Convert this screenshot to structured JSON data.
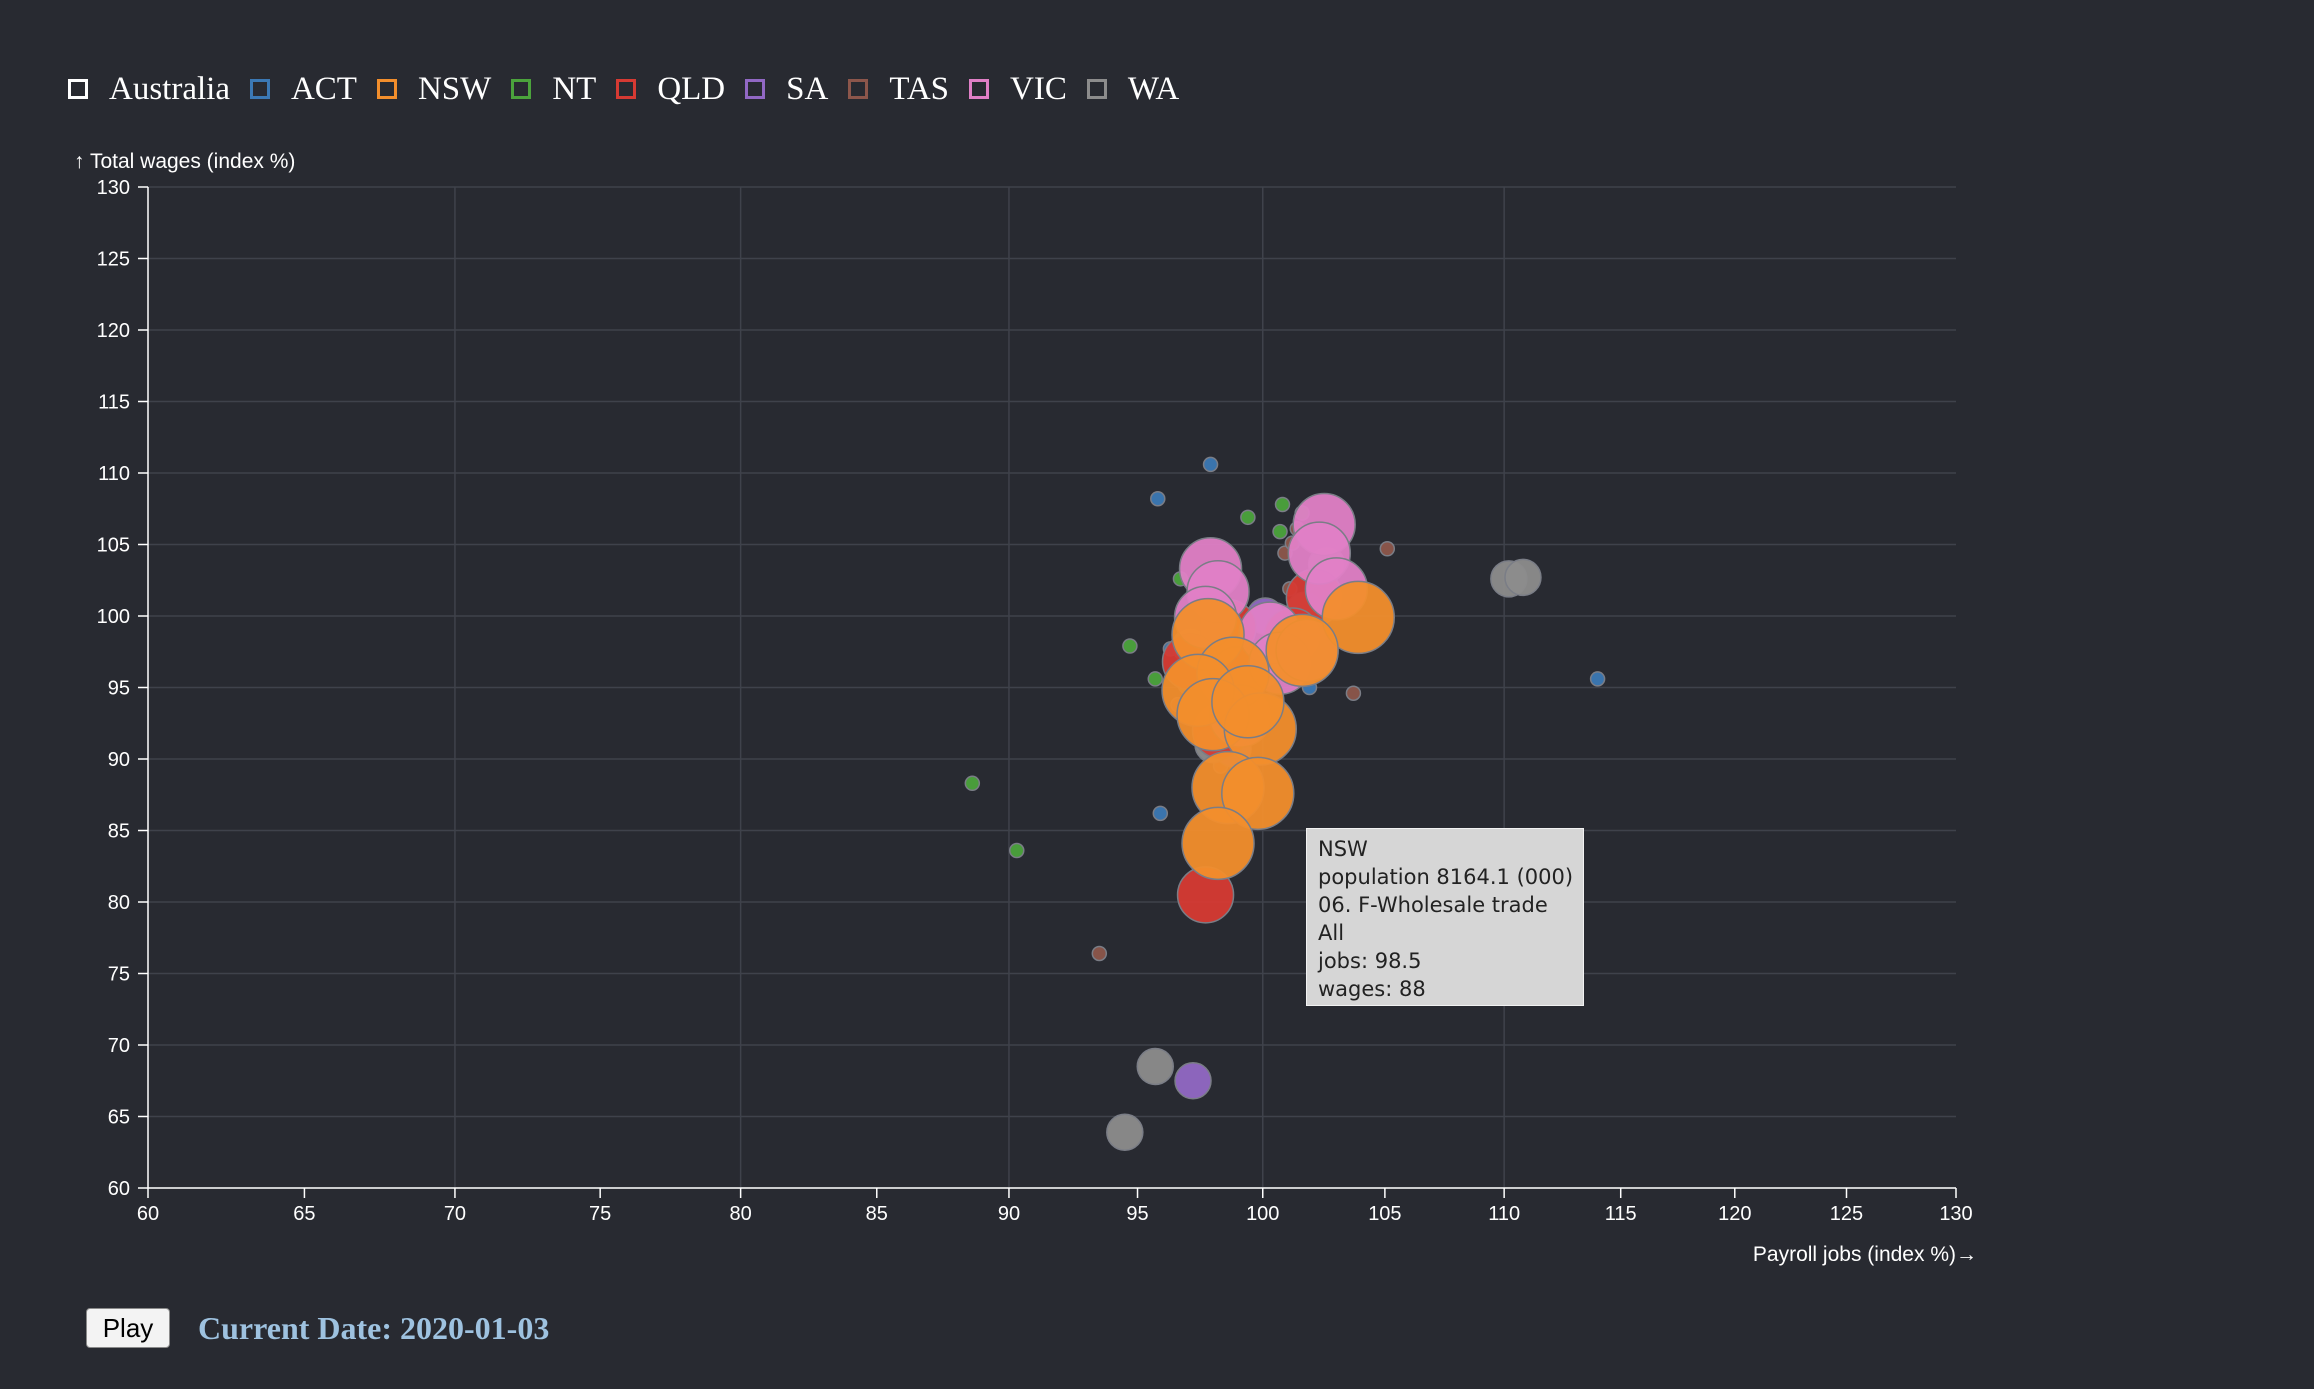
{
  "legend": [
    {
      "label": "Australia",
      "color": "#ffffff",
      "icon": "square-outline-icon"
    },
    {
      "label": "ACT",
      "color": "#3b78b4",
      "icon": "square-icon"
    },
    {
      "label": "NSW",
      "color": "#f28e2c",
      "icon": "square-icon"
    },
    {
      "label": "NT",
      "color": "#4ba33c",
      "icon": "square-icon"
    },
    {
      "label": "QLD",
      "color": "#d63a33",
      "icon": "square-icon"
    },
    {
      "label": "SA",
      "color": "#9168c4",
      "icon": "square-icon"
    },
    {
      "label": "TAS",
      "color": "#8c564b",
      "icon": "square-icon"
    },
    {
      "label": "VIC",
      "color": "#e07fc6",
      "icon": "square-icon"
    },
    {
      "label": "WA",
      "color": "#8c8c8c",
      "icon": "square-icon"
    }
  ],
  "chart_data": {
    "type": "scatter",
    "title": "",
    "xlabel": "Payroll jobs (index %)",
    "ylabel": "Total wages (index %)",
    "xlim": [
      60,
      130
    ],
    "ylim": [
      60,
      130
    ],
    "x_ticks": [
      60,
      65,
      70,
      75,
      80,
      85,
      90,
      95,
      100,
      105,
      110,
      115,
      120,
      125,
      130
    ],
    "y_ticks": [
      60,
      65,
      70,
      75,
      80,
      85,
      90,
      95,
      100,
      105,
      110,
      115,
      120,
      125,
      130
    ],
    "x_scale": "sqrt",
    "grid": "vertical lines at x = 70, 80, 90, 100, 110; horizontal lines at every y tick",
    "legend_position": "top-left",
    "size_encoding": "population (000)",
    "series": [
      {
        "name": "ACT",
        "color": "#3b78b4",
        "points": [
          [
            97.9,
            110.6,
            0
          ],
          [
            95.8,
            108.2,
            0
          ],
          [
            96.3,
            97.7,
            0
          ],
          [
            101.9,
            95.0,
            0
          ],
          [
            114.0,
            95.6,
            0
          ],
          [
            95.9,
            86.2,
            0
          ]
        ]
      },
      {
        "name": "NT",
        "color": "#4ba33c",
        "points": [
          [
            99.4,
            106.9,
            0
          ],
          [
            100.8,
            107.8,
            0
          ],
          [
            100.7,
            105.9,
            0
          ],
          [
            101.6,
            107.2,
            0
          ],
          [
            96.7,
            102.6,
            0
          ],
          [
            94.7,
            97.9,
            0
          ],
          [
            95.7,
            95.6,
            0
          ],
          [
            96.9,
            95.1,
            0
          ],
          [
            88.6,
            88.3,
            0
          ],
          [
            90.3,
            83.6,
            0
          ]
        ]
      },
      {
        "name": "TAS",
        "color": "#8c564b",
        "points": [
          [
            101.4,
            106.1,
            0
          ],
          [
            100.9,
            104.4,
            0
          ],
          [
            101.2,
            105.1,
            0
          ],
          [
            105.1,
            104.7,
            0
          ],
          [
            101.1,
            101.9,
            0
          ],
          [
            102.2,
            101.6,
            0
          ],
          [
            103.7,
            94.6,
            0
          ],
          [
            96.6,
            93.8,
            0
          ],
          [
            97.1,
            93.0,
            0
          ],
          [
            97.6,
            92.1,
            0
          ],
          [
            98.3,
            89.5,
            0
          ],
          [
            93.5,
            76.4,
            0
          ]
        ]
      },
      {
        "name": "SA",
        "color": "#9168c4",
        "points": [
          [
            100.1,
            100.0,
            2
          ],
          [
            99.3,
            92.7,
            2
          ],
          [
            98.8,
            90.7,
            2
          ],
          [
            101.4,
            97.9,
            2
          ],
          [
            97.2,
            67.5,
            2
          ]
        ]
      },
      {
        "name": "WA",
        "color": "#8c8c8c",
        "points": [
          [
            102.6,
            103.6,
            2
          ],
          [
            101.7,
            100.4,
            2
          ],
          [
            100.0,
            96.2,
            2
          ],
          [
            97.1,
            97.9,
            2
          ],
          [
            98.0,
            91.0,
            2
          ],
          [
            110.2,
            102.6,
            2
          ],
          [
            110.8,
            102.7,
            2
          ],
          [
            95.7,
            68.5,
            2
          ],
          [
            94.5,
            63.9,
            2
          ]
        ]
      },
      {
        "name": "QLD",
        "color": "#d63a33",
        "points": [
          [
            102.1,
            101.3,
            4
          ],
          [
            101.2,
            98.6,
            4
          ],
          [
            98.6,
            99.2,
            4
          ],
          [
            97.1,
            96.8,
            4
          ],
          [
            98.3,
            92.0,
            4
          ],
          [
            99.0,
            95.9,
            4
          ],
          [
            97.7,
            80.5,
            4
          ]
        ]
      },
      {
        "name": "VIC",
        "color": "#e07fc6",
        "points": [
          [
            102.5,
            106.4,
            5
          ],
          [
            102.3,
            104.4,
            5
          ],
          [
            103.0,
            101.9,
            5
          ],
          [
            97.9,
            103.3,
            5
          ],
          [
            98.2,
            101.7,
            5
          ],
          [
            97.7,
            99.9,
            5
          ],
          [
            100.3,
            98.8,
            5
          ],
          [
            100.7,
            96.7,
            5
          ],
          [
            101.8,
            97.6,
            5
          ],
          [
            99.1,
            93.0,
            5
          ]
        ]
      },
      {
        "name": "NSW",
        "color": "#f28e2c",
        "points": [
          [
            103.9,
            99.9,
            7
          ],
          [
            101.6,
            97.6,
            7
          ],
          [
            97.8,
            98.7,
            7
          ],
          [
            98.8,
            96.0,
            7
          ],
          [
            97.4,
            94.8,
            7
          ],
          [
            98.0,
            93.1,
            7
          ],
          [
            99.9,
            92.1,
            7
          ],
          [
            98.6,
            88.0,
            7
          ],
          [
            99.8,
            87.6,
            7
          ],
          [
            98.2,
            84.1,
            7
          ],
          [
            99.4,
            94.0,
            7
          ]
        ]
      }
    ]
  },
  "tooltip": {
    "lines": [
      "NSW",
      "population 8164.1 (000)",
      "06. F-Wholesale trade",
      "All",
      "jobs: 98.5",
      "wages: 88"
    ]
  },
  "controls": {
    "play_label": "Play",
    "current_date_label": "Current Date: 2020-01-03"
  }
}
